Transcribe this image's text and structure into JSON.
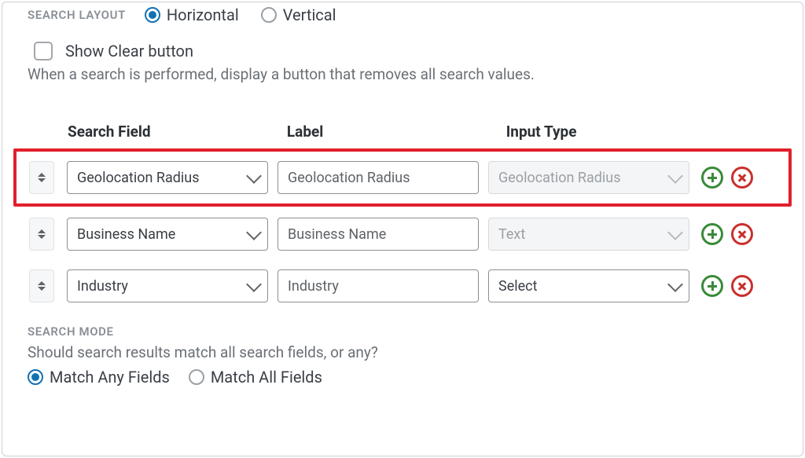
{
  "layout": {
    "header": "SEARCH LAYOUT",
    "options": {
      "horizontal": "Horizontal",
      "vertical": "Vertical"
    },
    "selected": "horizontal"
  },
  "clear": {
    "label": "Show Clear button",
    "help": "When a search is performed, display a button that removes all search values."
  },
  "columns": {
    "field": "Search Field",
    "label": "Label",
    "input": "Input Type"
  },
  "rows": [
    {
      "field": "Geolocation Radius",
      "label": "Geolocation Radius",
      "input": "Geolocation Radius",
      "input_disabled": true,
      "highlight": true
    },
    {
      "field": "Business Name",
      "label": "Business Name",
      "input": "Text",
      "input_disabled": true,
      "highlight": false
    },
    {
      "field": "Industry",
      "label": "Industry",
      "input": "Select",
      "input_disabled": false,
      "highlight": false
    }
  ],
  "mode": {
    "header": "SEARCH MODE",
    "help": "Should search results match all search fields, or any?",
    "options": {
      "any": "Match Any Fields",
      "all": "Match All Fields"
    },
    "selected": "any"
  }
}
